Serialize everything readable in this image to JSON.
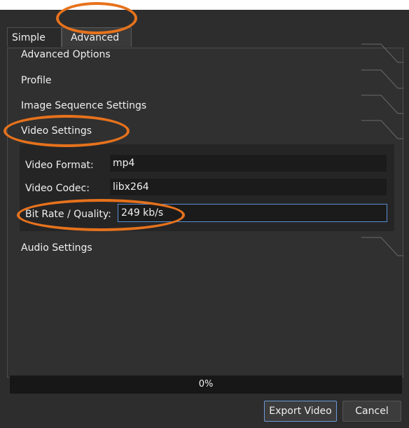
{
  "tabs": [
    {
      "label": "Simple"
    },
    {
      "label": "Advanced"
    }
  ],
  "sections": {
    "advanced_options": "Advanced Options",
    "profile": "Profile",
    "image_sequence": "Image Sequence Settings",
    "video_settings": "Video Settings",
    "audio_settings": "Audio Settings"
  },
  "video_settings": {
    "format_label": "Video Format:",
    "format_value": "mp4",
    "codec_label": "Video Codec:",
    "codec_value": "libx264",
    "bitrate_label": "Bit Rate / Quality:",
    "bitrate_value": "249 kb/s"
  },
  "progress": {
    "text": "0%",
    "fraction": 0
  },
  "buttons": {
    "export": "Export Video",
    "cancel": "Cancel"
  },
  "colors": {
    "annotation": "#e6721c",
    "focus": "#5a8fd6"
  }
}
